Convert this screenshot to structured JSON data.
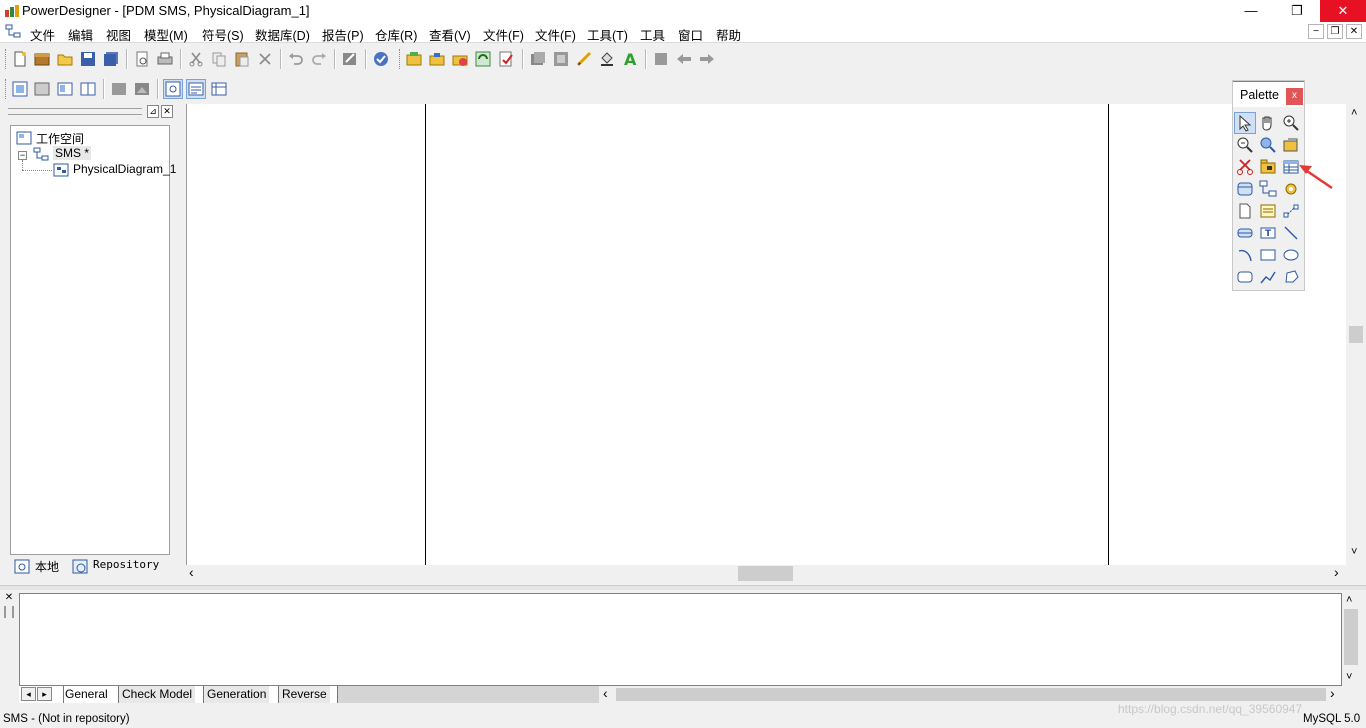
{
  "window": {
    "title": "PowerDesigner - [PDM SMS, PhysicalDiagram_1]",
    "minimize": "—",
    "maximize": "❐",
    "close": "✕"
  },
  "menu": {
    "items": [
      "文件",
      "编辑",
      "视图",
      "模型(M)",
      "符号(S)",
      "数据库(D)",
      "报告(P)",
      "仓库(R)",
      "查看(V)",
      "文件(F)",
      "文件(F)",
      "工具(T)",
      "工具",
      "窗口",
      "帮助"
    ],
    "mdi_min": "−",
    "mdi_restore": "❐",
    "mdi_close": "✕"
  },
  "browser": {
    "root": "工作空间",
    "model": "SMS *",
    "diagram": "PhysicalDiagram_1",
    "tab_local": "本地",
    "tab_repository": "Repository",
    "close": "✕",
    "pin": "⊿"
  },
  "palette": {
    "title": "Palette",
    "close": "x",
    "tools": [
      "pointer-tool",
      "grabber-tool",
      "zoom-in-tool",
      "zoom-out-tool",
      "open-package-tool",
      "properties-tool",
      "delete-tool",
      "package-tool",
      "table-tool",
      "view-tool",
      "reference-tool",
      "procedure-tool",
      "file-tool",
      "text-note-tool",
      "link-tool",
      "storage-tool",
      "title-tool",
      "line-tool",
      "arc-tool",
      "rectangle-tool",
      "ellipse-tool",
      "rounded-rectangle-tool",
      "polyline-tool",
      "polygon-tool"
    ]
  },
  "output": {
    "tabs": [
      "General",
      "Check Model",
      "Generation",
      "Reverse"
    ],
    "close": "✕"
  },
  "status": {
    "left": "SMS - (Not in repository)",
    "right": "MySQL 5.0",
    "watermark": "https://blog.csdn.net/qq_39560947"
  },
  "scroll": {
    "left": "‹",
    "right": "›",
    "up": "˄",
    "down": "˅"
  }
}
